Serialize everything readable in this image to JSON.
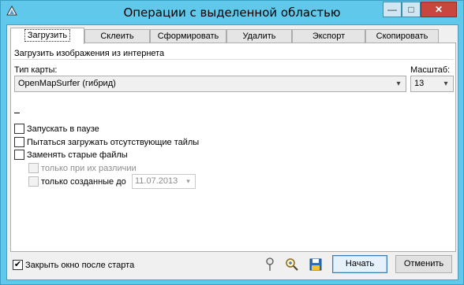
{
  "window": {
    "title": "Операции с выделенной областью",
    "min_glyph": "—",
    "max_glyph": "□",
    "close_glyph": "✕"
  },
  "tabs": [
    {
      "label": "Загрузить",
      "active": true
    },
    {
      "label": "Склеить",
      "active": false
    },
    {
      "label": "Сформировать",
      "active": false
    },
    {
      "label": "Удалить",
      "active": false
    },
    {
      "label": "Экспорт",
      "active": false
    },
    {
      "label": "Скопировать",
      "active": false
    }
  ],
  "download": {
    "section_title": "Загрузить изображения из интернета",
    "map_type_label": "Тип карты:",
    "map_type_value": "OpenMapSurfer (гибрид)",
    "scale_label": "Масштаб:",
    "scale_value": "13",
    "options": {
      "start_paused": {
        "label": "Запускать в паузе",
        "checked": false
      },
      "retry_missing": {
        "label": "Пытаться загружать отсутствующие тайлы",
        "checked": false
      },
      "replace_old": {
        "label": "Заменять старые файлы",
        "checked": false
      },
      "only_if_different": {
        "label": "только при их различии",
        "checked": false,
        "enabled": false
      },
      "only_created_before": {
        "label": "только созданные до",
        "checked": false,
        "date": "11.07.2013"
      }
    }
  },
  "footer": {
    "close_after_start": {
      "label": "Закрыть окно после старта",
      "checked": true
    },
    "start_button": "Начать",
    "cancel_button": "Отменить"
  },
  "colors": {
    "frame": "#60c8ea",
    "close_button": "#c7463d",
    "default_button_border": "#3c7fb1"
  }
}
